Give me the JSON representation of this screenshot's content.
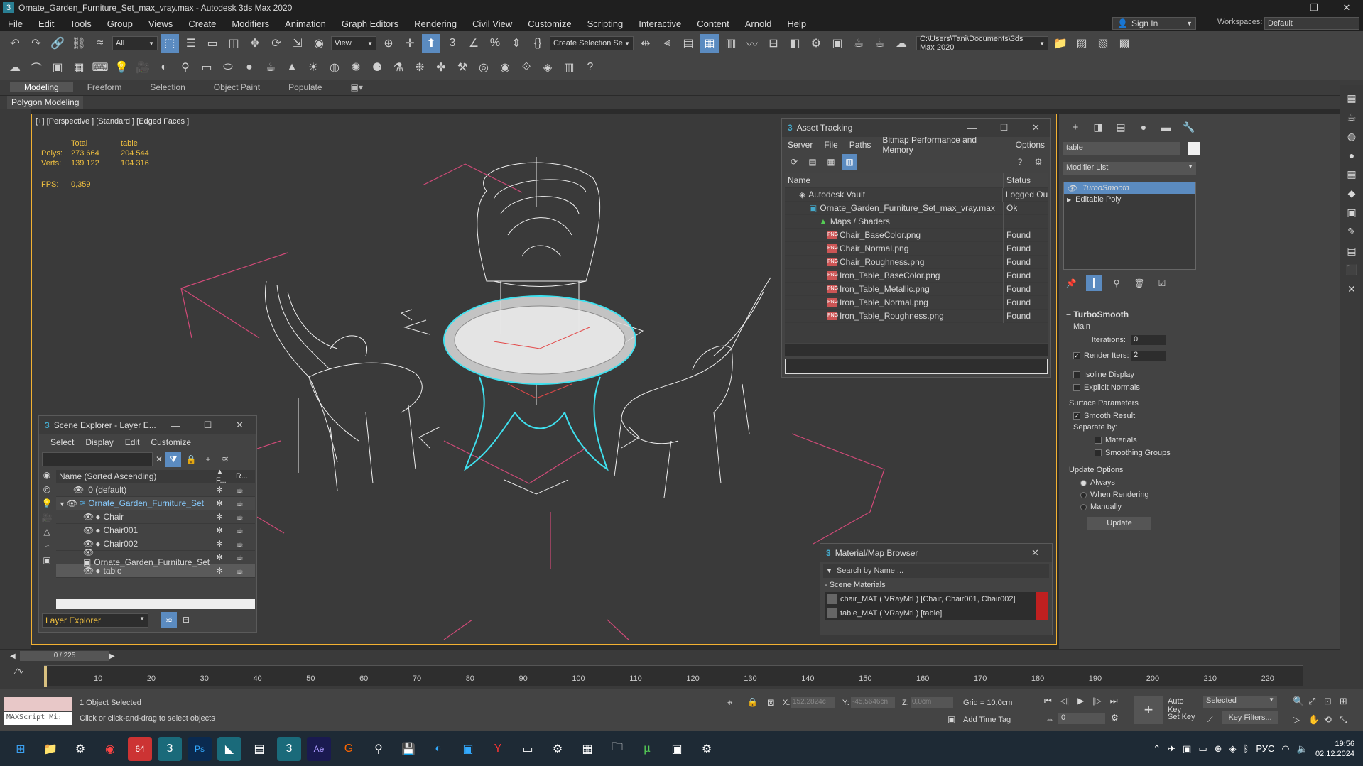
{
  "app": {
    "title": "Ornate_Garden_Furniture_Set_max_vray.max - Autodesk 3ds Max 2020",
    "logo_letter": "3"
  },
  "menu": [
    "File",
    "Edit",
    "Tools",
    "Group",
    "Views",
    "Create",
    "Modifiers",
    "Animation",
    "Graph Editors",
    "Rendering",
    "Civil View",
    "Customize",
    "Scripting",
    "Interactive",
    "Content",
    "Arnold",
    "Help"
  ],
  "header": {
    "signin": "Sign In",
    "workspaces_label": "Workspaces:",
    "workspace": "Default"
  },
  "toolbar": {
    "filter_all": "All",
    "ref_coord": "View",
    "selection_set": "Create Selection Se",
    "path": "C:\\Users\\Tani\\Documents\\3ds Max 2020"
  },
  "ribbon": {
    "tabs": [
      "Modeling",
      "Freeform",
      "Selection",
      "Object Paint",
      "Populate"
    ],
    "active": "Modeling",
    "sub": "Polygon Modeling"
  },
  "viewport": {
    "label": "[+] [Perspective ] [Standard ] [Edged Faces ]",
    "stats": {
      "col_total": "Total",
      "col_sel": "table",
      "polys_label": "Polys:",
      "polys_total": "273 664",
      "polys_sel": "204 544",
      "verts_label": "Verts:",
      "verts_total": "139 122",
      "verts_sel": "104 316",
      "fps_label": "FPS:",
      "fps_value": "0,359"
    }
  },
  "asset_tracking": {
    "title": "Asset Tracking",
    "menu": [
      "Server",
      "File",
      "Paths",
      "Bitmap Performance and Memory",
      "Options"
    ],
    "col_name": "Name",
    "col_status": "Status",
    "rows": [
      {
        "name": "Autodesk Vault",
        "status": "Logged Ou",
        "indent": 1,
        "icon": "vault"
      },
      {
        "name": "Ornate_Garden_Furniture_Set_max_vray.max",
        "status": "Ok",
        "indent": 2,
        "icon": "max"
      },
      {
        "name": "Maps / Shaders",
        "status": "",
        "indent": 3,
        "icon": "maps"
      },
      {
        "name": "Chair_BaseColor.png",
        "status": "Found",
        "indent": 4,
        "icon": "png"
      },
      {
        "name": "Chair_Normal.png",
        "status": "Found",
        "indent": 4,
        "icon": "png"
      },
      {
        "name": "Chair_Roughness.png",
        "status": "Found",
        "indent": 4,
        "icon": "png"
      },
      {
        "name": "Iron_Table_BaseColor.png",
        "status": "Found",
        "indent": 4,
        "icon": "png"
      },
      {
        "name": "Iron_Table_Metallic.png",
        "status": "Found",
        "indent": 4,
        "icon": "png"
      },
      {
        "name": "Iron_Table_Normal.png",
        "status": "Found",
        "indent": 4,
        "icon": "png"
      },
      {
        "name": "Iron_Table_Roughness.png",
        "status": "Found",
        "indent": 4,
        "icon": "png"
      }
    ]
  },
  "scene_explorer": {
    "title": "Scene Explorer - Layer E...",
    "menu": [
      "Select",
      "Display",
      "Edit",
      "Customize"
    ],
    "col_name": "Name (Sorted Ascending)",
    "col_f": "▲ F...",
    "col_r": "R...",
    "rows": [
      {
        "name": "0 (default)",
        "indent": 0,
        "selected": false
      },
      {
        "name": "Ornate_Garden_Furniture_Set",
        "indent": 0,
        "selected": false
      },
      {
        "name": "Chair",
        "indent": 1,
        "selected": false
      },
      {
        "name": "Chair001",
        "indent": 1,
        "selected": false
      },
      {
        "name": "Chair002",
        "indent": 1,
        "selected": false
      },
      {
        "name": "Ornate_Garden_Furniture_Set",
        "indent": 1,
        "selected": false
      },
      {
        "name": "table",
        "indent": 1,
        "selected": true
      }
    ],
    "footer": "Layer Explorer"
  },
  "material_browser": {
    "title": "Material/Map Browser",
    "search_placeholder": "Search by Name ...",
    "section": "- Scene Materials",
    "items": [
      "chair_MAT ( VRayMtl ) [Chair, Chair001, Chair002]",
      "table_MAT ( VRayMtl ) [table]"
    ]
  },
  "command_panel": {
    "object_name": "table",
    "modifier_list": "Modifier List",
    "stack": [
      "TurboSmooth",
      "Editable Poly"
    ],
    "turbosmooth": {
      "title": "TurboSmooth",
      "main": "Main",
      "iterations_label": "Iterations:",
      "iterations": "0",
      "render_iters_label": "Render Iters:",
      "render_iters": "2",
      "isoline": "Isoline Display",
      "explicit": "Explicit Normals",
      "surface": "Surface Parameters",
      "smooth_result": "Smooth Result",
      "separate_by": "Separate by:",
      "materials": "Materials",
      "smoothing_groups": "Smoothing Groups",
      "update_options": "Update Options",
      "always": "Always",
      "when_rendering": "When Rendering",
      "manually": "Manually",
      "update_btn": "Update"
    }
  },
  "timeline": {
    "frame": "0 / 225",
    "ticks": [
      "10",
      "20",
      "30",
      "40",
      "50",
      "60",
      "70",
      "80",
      "90",
      "100",
      "110",
      "120",
      "130",
      "140",
      "150",
      "160",
      "170",
      "180",
      "190",
      "200",
      "210",
      "220"
    ]
  },
  "statusbar": {
    "maxscript": "MAXScript Mi:",
    "selected": "1 Object Selected",
    "prompt": "Click or click-and-drag to select objects",
    "x_label": "X:",
    "x_val": "152,2824c",
    "y_label": "Y:",
    "y_val": "-45,5646cn",
    "z_label": "Z:",
    "z_val": "0,0cm",
    "grid": "Grid = 10,0cm",
    "add_time_tag": "Add Time Tag",
    "auto_key": "Auto Key",
    "set_key": "Set Key",
    "selected_dd": "Selected",
    "key_filters": "Key Filters...",
    "frame_field": "0"
  },
  "taskbar": {
    "lang": "РУС",
    "time": "19:56",
    "date": "02.12.2024"
  }
}
